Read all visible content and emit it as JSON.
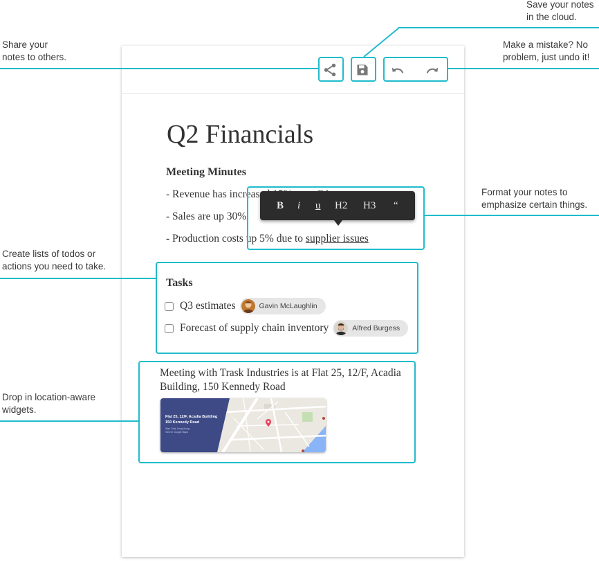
{
  "callouts": {
    "share": "Share your\nnotes to others.",
    "save": "Save your notes\nin the cloud.",
    "undo": "Make a mistake? No\nproblem, just undo it!",
    "format": "Format your notes to\nemphasize certain things.",
    "lists": "Create lists of todos or\nactions you need to take.",
    "widgets": "Drop in location-aware\nwidgets."
  },
  "toolbar": {
    "share_icon": "share-icon",
    "save_icon": "save-icon",
    "undo_icon": "undo-icon",
    "redo_icon": "redo-icon"
  },
  "document": {
    "title": "Q2 Financials",
    "section_heading": "Meeting Minutes",
    "bullets": [
      "- Revenue has increased 15% over Q1",
      "- Sales are up 30%",
      "- Production costs up 5% due to "
    ],
    "underlined_link": "supplier issues"
  },
  "format_bar": {
    "bold": "B",
    "italic": "i",
    "underline": "u",
    "h2": "H2",
    "h3": "H3",
    "quote": "“"
  },
  "tasks": {
    "heading": "Tasks",
    "items": [
      {
        "label": "Q3 estimates",
        "assignee": "Gavin McLaughlin",
        "checked": false
      },
      {
        "label": "Forecast of supply chain inventory",
        "assignee": "Alfred Burgess",
        "checked": false
      }
    ]
  },
  "location": {
    "text": "Meeting with Trask Industries is at Flat 25, 12/F, Acadia Building, 150 Kennedy Road",
    "card_title": "Flat 25, 12/F, Acadia Building\n150 Kennedy Road",
    "card_sub": "Wan Chai, Hong Kong\nView in Google Maps"
  },
  "colors": {
    "accent": "#1fbccb",
    "format_bar_bg": "#2c2c2c",
    "map_panel": "#3d4a86"
  }
}
